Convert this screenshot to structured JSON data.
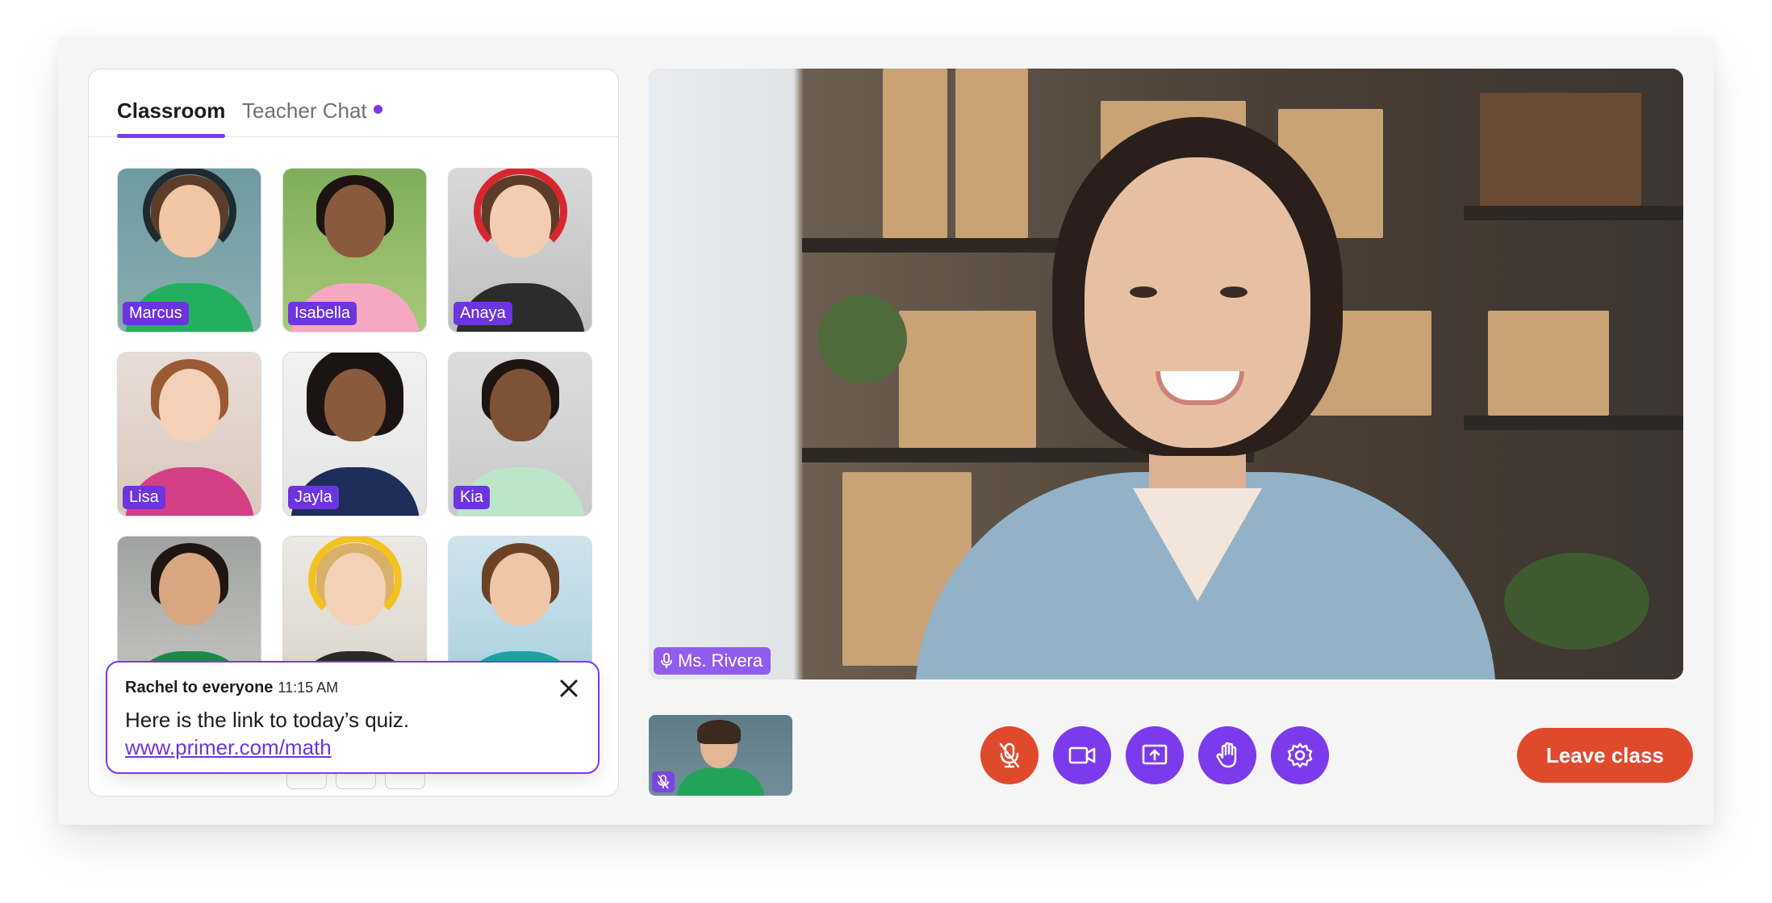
{
  "tabs": {
    "classroom": "Classroom",
    "teacher_chat": "Teacher Chat"
  },
  "students": [
    {
      "name": "Marcus"
    },
    {
      "name": "Isabella"
    },
    {
      "name": "Anaya"
    },
    {
      "name": "Lisa"
    },
    {
      "name": "Jayla"
    },
    {
      "name": "Kia"
    }
  ],
  "chat_toast": {
    "sender": "Rachel to everyone",
    "time": "11:15 AM",
    "message": "Here is the link to today’s quiz.",
    "link": "www.primer.com/math"
  },
  "main_video": {
    "speaker": "Ms. Rivera"
  },
  "controls": {
    "leave_label": "Leave class",
    "mute_icon": "mic-off-icon",
    "camera_icon": "video-icon",
    "share_icon": "screen-share-icon",
    "hand_icon": "raise-hand-icon",
    "settings_icon": "gear-icon"
  },
  "colors": {
    "accent": "#7c3aed",
    "danger": "#e04a2c"
  }
}
